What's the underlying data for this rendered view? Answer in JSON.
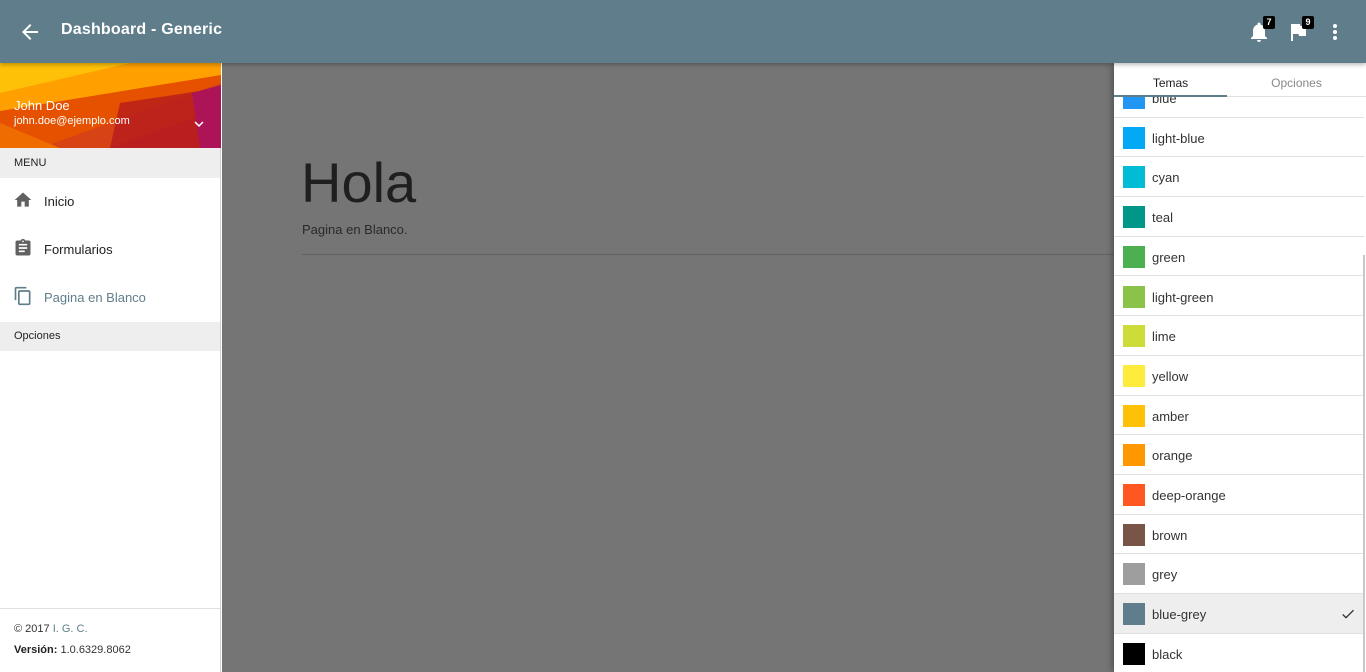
{
  "header": {
    "title": "Dashboard - Generic",
    "notifications_count": "7",
    "flags_count": "9"
  },
  "sidebar": {
    "user": {
      "name": "John Doe",
      "email": "john.doe@ejemplo.com"
    },
    "menu_header": "MENU",
    "items": [
      {
        "label": "Inicio",
        "icon": "home-icon"
      },
      {
        "label": "Formularios",
        "icon": "clipboard-icon"
      },
      {
        "label": "Pagina en Blanco",
        "icon": "copy-icon",
        "active": true
      }
    ],
    "options_header": "Opciones",
    "footer": {
      "copyright_prefix": "© 2017",
      "company": "I. G. C.",
      "version_label": "Versión:",
      "version": "1.0.6329.8062"
    }
  },
  "main": {
    "title": "Hola",
    "subtitle": "Pagina en Blanco."
  },
  "panel": {
    "tabs": [
      {
        "label": "Temas"
      },
      {
        "label": "Opciones"
      }
    ],
    "themes": [
      {
        "label": "blue",
        "color": "#2196f3"
      },
      {
        "label": "light-blue",
        "color": "#03a9f4"
      },
      {
        "label": "cyan",
        "color": "#00bcd4"
      },
      {
        "label": "teal",
        "color": "#009688"
      },
      {
        "label": "green",
        "color": "#4caf50"
      },
      {
        "label": "light-green",
        "color": "#8bc34a"
      },
      {
        "label": "lime",
        "color": "#cddc39"
      },
      {
        "label": "yellow",
        "color": "#ffeb3b"
      },
      {
        "label": "amber",
        "color": "#ffc107"
      },
      {
        "label": "orange",
        "color": "#ff9800"
      },
      {
        "label": "deep-orange",
        "color": "#ff5722"
      },
      {
        "label": "brown",
        "color": "#795548"
      },
      {
        "label": "grey",
        "color": "#9e9e9e"
      },
      {
        "label": "blue-grey",
        "color": "#607d8b",
        "selected": true
      },
      {
        "label": "black",
        "color": "#000000"
      }
    ]
  },
  "colors": {
    "primary": "#607d8b",
    "overlay": "#757575"
  }
}
